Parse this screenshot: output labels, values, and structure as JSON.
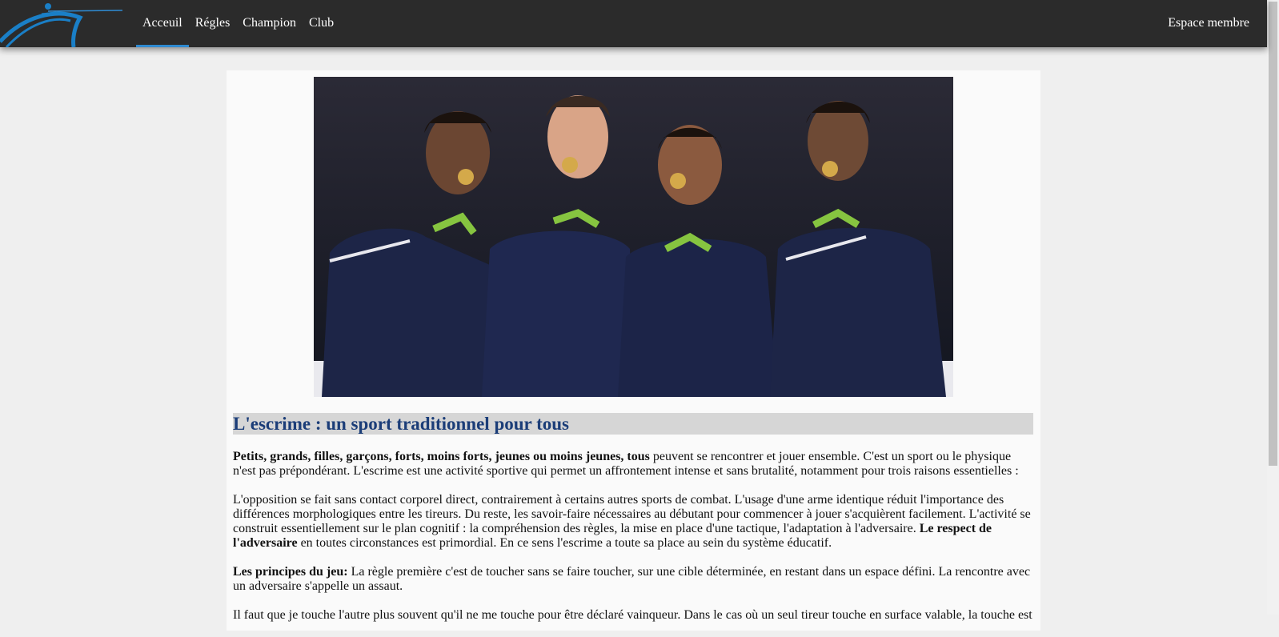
{
  "nav": {
    "logo_icon": "fencer-logo-icon",
    "items": [
      {
        "label": "Acceuil",
        "active": true
      },
      {
        "label": "Régles",
        "active": false
      },
      {
        "label": "Champion",
        "active": false
      },
      {
        "label": "Club",
        "active": false
      }
    ],
    "member_label": "Espace membre",
    "accent_color": "#2f8ad1"
  },
  "hero": {
    "image_icon": "team-medal-photo"
  },
  "article": {
    "title": "L'escrime : un sport traditionnel pour tous",
    "p1_bold": "Petits, grands, filles, garçons, forts, moins forts, jeunes ou moins jeunes, tous",
    "p1_text": " peuvent se rencontrer et jouer ensemble. C'est un sport ou le physique n'est pas prépondérant. L'escrime est une activité sportive qui permet un affrontement intense et sans brutalité, notamment pour trois raisons essentielles :",
    "p2_text": "L'opposition se fait sans contact corporel direct, contrairement à certains autres sports de combat. L'usage d'une arme identique réduit l'importance des différences morphologiques entre les tireurs. Du reste, les savoir-faire nécessaires au débutant pour commencer à jouer s'acquièrent facilement. L'activité se construit essentiellement sur le plan cognitif : la compréhension des règles, la mise en place d'une tactique, l'adaptation à l'adversaire. ",
    "p2_bold": "Le respect de l'adversaire",
    "p2_end": " en toutes circonstances est primordial. En ce sens l'escrime a toute sa place au sein du système éducatif.",
    "p3_bold": "Les principes du jeu:",
    "p3_text": " La règle première c'est de toucher sans se faire toucher, sur une cible déterminée, en restant dans un espace défini. La rencontre avec un adversaire s'appelle un assaut.",
    "p4_text": "Il faut que je touche l'autre plus souvent qu'il ne me touche pour être déclaré vainqueur. Dans le cas où un seul tireur touche en surface valable, la touche est"
  }
}
